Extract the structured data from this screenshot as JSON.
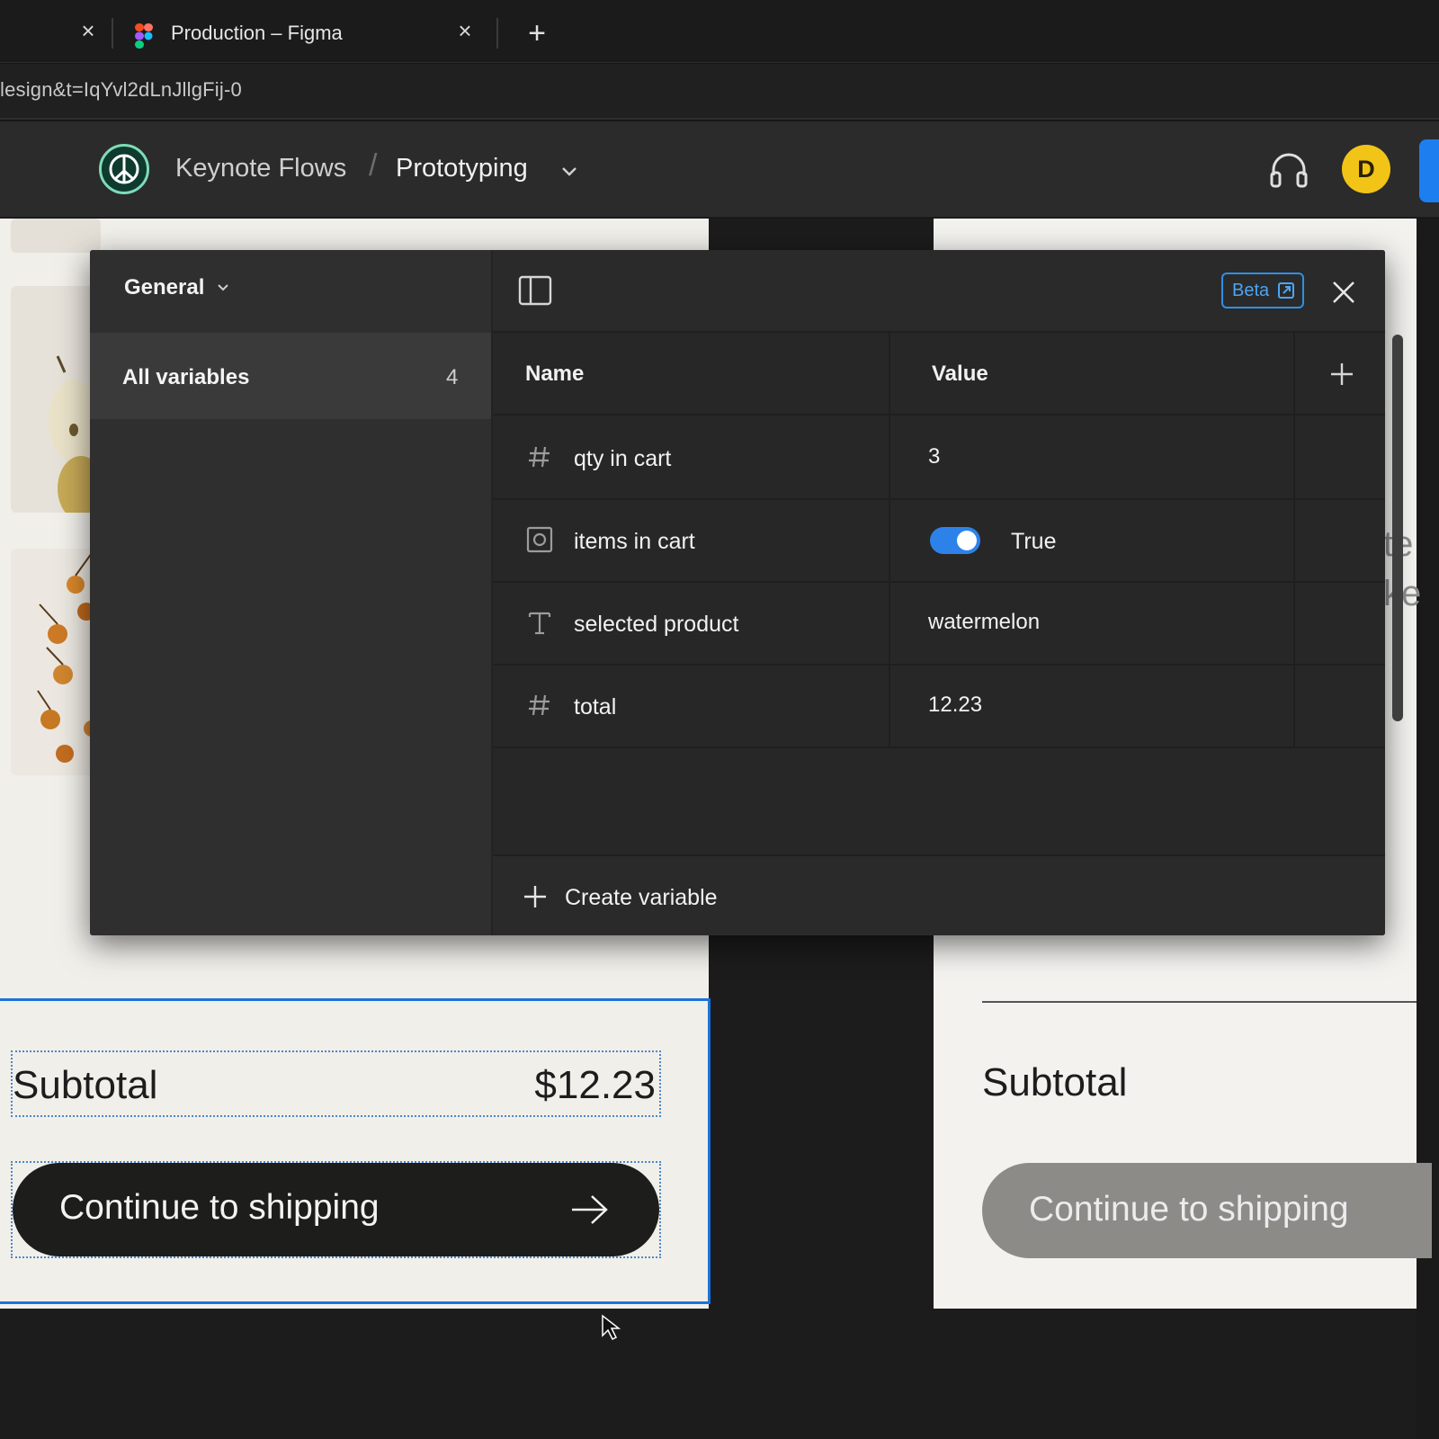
{
  "browser": {
    "tab_title": "Production – Figma",
    "new_tab_label": "+",
    "url": "lesign&t=IqYvl2dLnJllgFij-0"
  },
  "toolbar": {
    "project_name": "Keynote Flows",
    "separator": "/",
    "file_name": "Prototyping",
    "avatar_initial": "D"
  },
  "variables_modal": {
    "collection": "General",
    "groups": [
      {
        "label": "All variables",
        "count": "4"
      }
    ],
    "beta_label": "Beta",
    "columns": {
      "name": "Name",
      "value": "Value"
    },
    "variables": [
      {
        "type": "number",
        "icon": "hash-icon",
        "name": "qty in cart",
        "value": "3"
      },
      {
        "type": "boolean",
        "icon": "boolean-icon",
        "name": "items in cart",
        "value": "True",
        "enabled": true
      },
      {
        "type": "string",
        "icon": "text-type-icon",
        "name": "selected product",
        "value": "watermelon"
      },
      {
        "type": "number",
        "icon": "hash-icon",
        "name": "total",
        "value": "12.23"
      }
    ],
    "create_label": "Create variable"
  },
  "canvas": {
    "left_frame": {
      "subtotal_label": "Subtotal",
      "subtotal_value": "$12.23",
      "cta_label": "Continue to shipping"
    },
    "right_frame": {
      "subtotal_label": "Subtotal",
      "cta_label": "Continue to shipping",
      "peek_text_1": "te",
      "peek_text_2": "ke"
    }
  },
  "colors": {
    "accent_blue": "#2d82ea",
    "selection_blue": "#1a73d9",
    "avatar_yellow": "#f2c417",
    "team_logo_green": "#7ddcb8"
  }
}
